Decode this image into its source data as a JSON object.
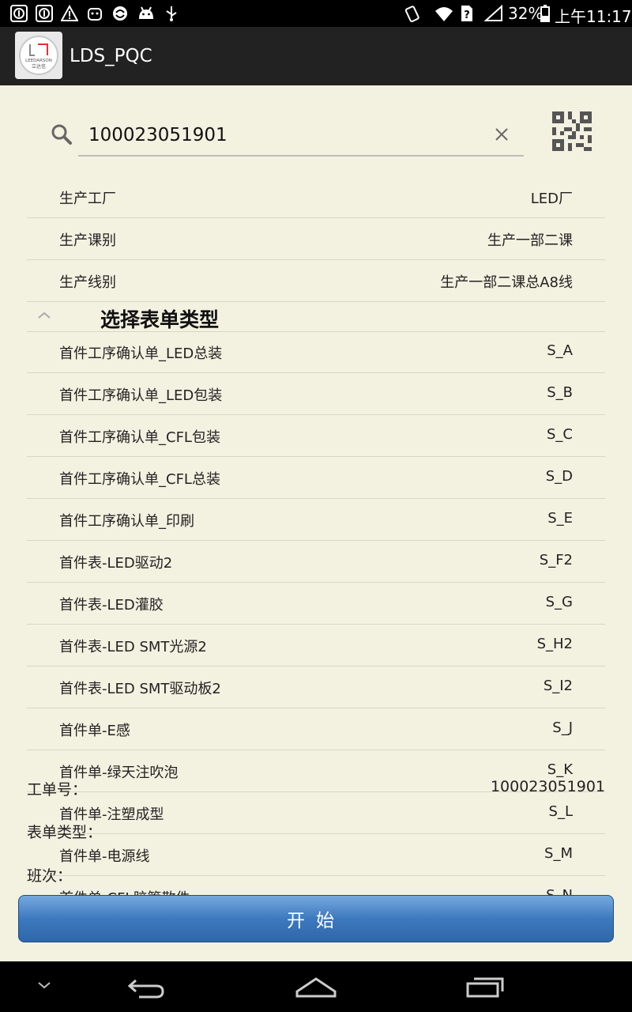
{
  "status_bar": {
    "battery_percent": "32%",
    "time": "上午11:17",
    "icons": [
      "info-notification-icon",
      "info-notification-icon",
      "warning-icon",
      "robot-icon",
      "sync-icon",
      "android-icon",
      "usb-icon",
      "screen-rotate-icon",
      "wifi-icon",
      "sim-unknown-icon",
      "signal-icon",
      "battery-charging-icon"
    ]
  },
  "action_bar": {
    "title": "LDS_PQC",
    "logo_text": "LEEDARSON",
    "logo_subtext": "立达信"
  },
  "search": {
    "value": "100023051901"
  },
  "info_rows": [
    {
      "label": "生产工厂",
      "value": "LED厂"
    },
    {
      "label": "生产课别",
      "value": "生产一部二课"
    },
    {
      "label": "生产线别",
      "value": "生产一部二课总A8线"
    }
  ],
  "form_section": {
    "title": "选择表单类型",
    "items": [
      {
        "label": "首件工序确认单_LED总装",
        "code": "S_A"
      },
      {
        "label": "首件工序确认单_LED包装",
        "code": "S_B"
      },
      {
        "label": "首件工序确认单_CFL包装",
        "code": "S_C"
      },
      {
        "label": "首件工序确认单_CFL总装",
        "code": "S_D"
      },
      {
        "label": "首件工序确认单_印刷",
        "code": "S_E"
      },
      {
        "label": "首件表-LED驱动2",
        "code": "S_F2"
      },
      {
        "label": "首件表-LED灌胶",
        "code": "S_G"
      },
      {
        "label": "首件表-LED SMT光源2",
        "code": "S_H2"
      },
      {
        "label": "首件表-LED SMT驱动板2",
        "code": "S_I2"
      },
      {
        "label": "首件单-E感",
        "code": "S_J"
      },
      {
        "label": "首件单-绿天注吹泡",
        "code": "S_K"
      },
      {
        "label": "首件单-注塑成型",
        "code": "S_L"
      },
      {
        "label": "首件单-电源线",
        "code": "S_M"
      },
      {
        "label": "首件单-CFL胶管散件",
        "code": "S_N"
      }
    ]
  },
  "summary": {
    "work_order_label": "工单号：",
    "work_order_value": "100023051901",
    "form_type_label": "表单类型：",
    "shift_label": "班次："
  },
  "start_button": {
    "label": "开始"
  },
  "colors": {
    "background": "#f3f1e0",
    "action_bar": "#222222",
    "button_blue": "#3d79bf"
  }
}
